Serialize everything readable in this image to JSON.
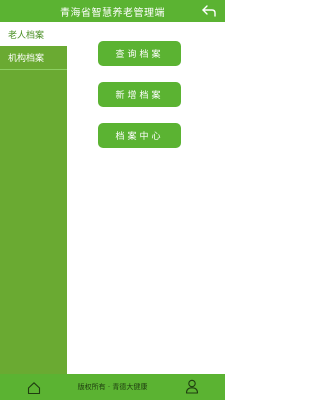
{
  "header": {
    "title": "青海省智慧养老管理端",
    "back_icon": "back-arrow-icon"
  },
  "sidebar": {
    "items": [
      {
        "label": "老人档案",
        "active": true
      },
      {
        "label": "机构档案",
        "active": false
      }
    ]
  },
  "main": {
    "buttons": [
      {
        "label": "查询档案"
      },
      {
        "label": "新增档案"
      },
      {
        "label": "档案中心"
      }
    ]
  },
  "footer": {
    "copyright": "版权所有 · 青德大健康",
    "home_icon": "home-icon",
    "user_icon": "user-icon"
  },
  "colors": {
    "primary": "#5bb332",
    "sidebar": "#6aaa32",
    "background": "#ffffff"
  }
}
